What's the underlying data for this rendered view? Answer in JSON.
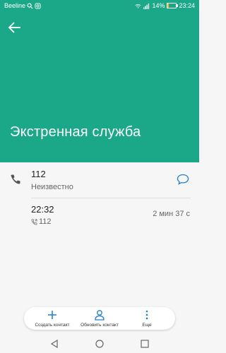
{
  "status_bar": {
    "carrier": "Beeline",
    "battery": "14%",
    "time": "23:24"
  },
  "header": {
    "title": "Экстренная служба"
  },
  "contact": {
    "number": "112",
    "label": "Неизвестно"
  },
  "call_log": [
    {
      "time": "22:32",
      "number": "112",
      "duration": "2 мин 37 с"
    }
  ],
  "toolbar": {
    "create": "Создать контакт",
    "update": "Обновить контакт",
    "more": "Еще"
  },
  "colors": {
    "accent": "#1aa889",
    "link": "#1f7fd6",
    "battery_low": "#f0c020"
  }
}
